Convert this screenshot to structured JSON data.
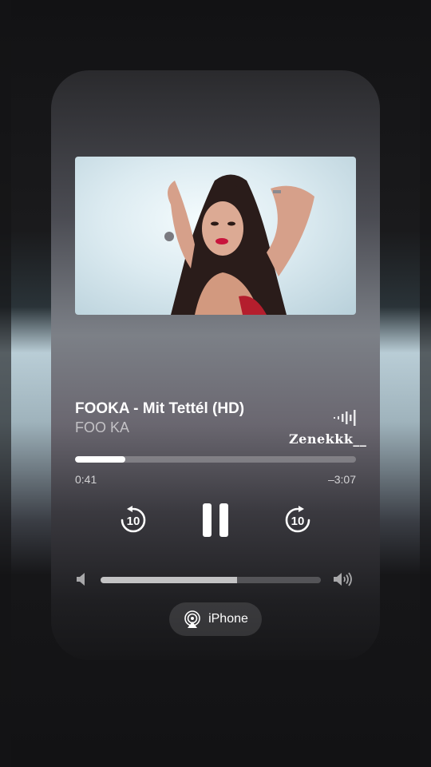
{
  "track": {
    "title": "FOOKA - Mit Tettél (HD)",
    "artist": "FOO KA",
    "elapsed": "0:41",
    "remaining": "–3:07",
    "progress_fraction": 0.18
  },
  "watermark": "Zenekkk__",
  "controls": {
    "skip_back_seconds": "10",
    "skip_forward_seconds": "10"
  },
  "volume": {
    "level_fraction": 0.62
  },
  "output": {
    "device_label": "iPhone"
  },
  "colors": {
    "accent": "#ffffff",
    "lipstick": "#c8143c",
    "hair": "#2a1c1a",
    "skin": "#d9a48e"
  },
  "icons": {
    "skip_back": "gobackward-10-icon",
    "play_state": "pause-icon",
    "skip_forward": "goforward-10-icon",
    "volume_low": "speaker-icon",
    "volume_high": "speaker-wave-icon",
    "output": "airplay-audio-icon",
    "live": "waveform-icon"
  }
}
